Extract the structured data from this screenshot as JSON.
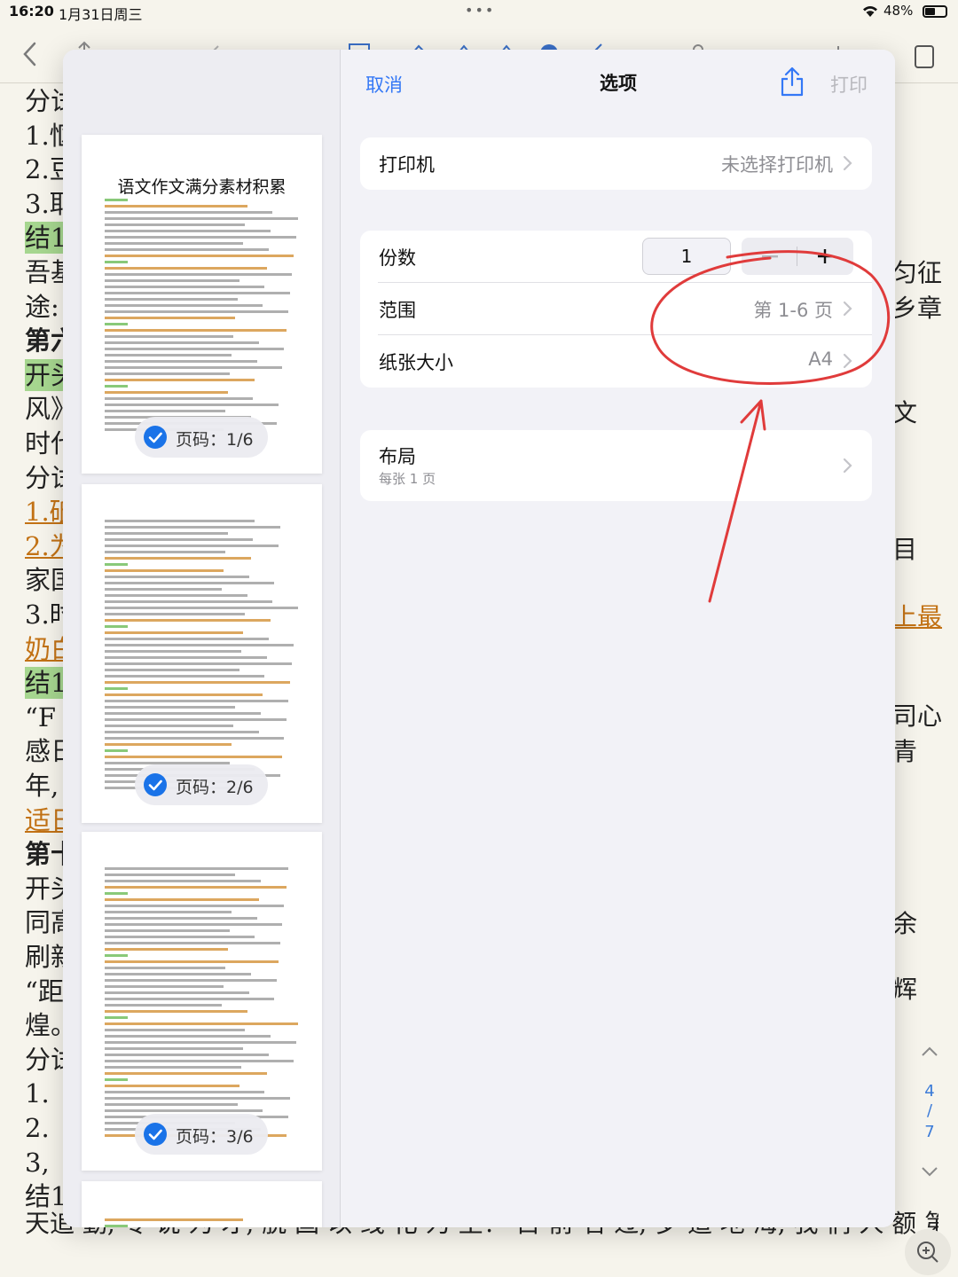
{
  "status_bar": {
    "time": "16:20",
    "date": "1月31日周三",
    "dots": "•••",
    "battery_text": "48%",
    "battery_level": 0.48
  },
  "background_doc": {
    "left_lines": [
      {
        "text": "分试",
        "style": "normal"
      },
      {
        "text": "1.怄",
        "style": "normal"
      },
      {
        "text": "2.豆",
        "style": "normal"
      },
      {
        "text": "3.耶",
        "style": "normal"
      },
      {
        "text": "结1",
        "style": "green"
      },
      {
        "text": "吾基",
        "style": "normal"
      },
      {
        "text": "途:",
        "style": "normal"
      },
      {
        "text": "第六",
        "style": "bold"
      },
      {
        "text": "开头",
        "style": "green"
      },
      {
        "text": "风》",
        "style": "normal"
      },
      {
        "text": "时代",
        "style": "normal"
      },
      {
        "text": "分试",
        "style": "normal"
      },
      {
        "text": "1.砥",
        "style": "orange"
      },
      {
        "text": "2.为",
        "style": "orange"
      },
      {
        "text": "家国",
        "style": "normal"
      },
      {
        "text": "3.时",
        "style": "normal"
      },
      {
        "text": "奶白",
        "style": "orange"
      },
      {
        "text": "结1",
        "style": "green"
      },
      {
        "text": "“F",
        "style": "normal"
      },
      {
        "text": "感日",
        "style": "normal"
      },
      {
        "text": "年,",
        "style": "normal"
      },
      {
        "text": "适日",
        "style": "orange"
      },
      {
        "text": "第十",
        "style": "bold"
      },
      {
        "text": "开头",
        "style": "normal"
      },
      {
        "text": "同高",
        "style": "normal"
      },
      {
        "text": "刷新",
        "style": "normal"
      },
      {
        "text": "“距",
        "style": "normal"
      },
      {
        "text": "煌。",
        "style": "normal"
      },
      {
        "text": "分试",
        "style": "normal"
      },
      {
        "text": "1.",
        "style": "normal"
      },
      {
        "text": "2.",
        "style": "normal"
      },
      {
        "text": "3,",
        "style": "normal"
      },
      {
        "text": "结1",
        "style": "normal"
      }
    ],
    "right_lines": [
      {
        "text": "匀征",
        "style": "normal"
      },
      {
        "text": "乡章",
        "style": "normal"
      },
      {
        "text": "文",
        "style": "normal"
      },
      {
        "text": "目",
        "style": "normal"
      },
      {
        "text": "上最",
        "style": "orange"
      },
      {
        "text": "司心",
        "style": "normal"
      },
      {
        "text": "青",
        "style": "normal"
      },
      {
        "text": "余",
        "style": "normal"
      },
      {
        "text": "辉",
        "style": "normal"
      }
    ],
    "bottom_line": "天追 勤,  专 说 为 才,  脱 国 以 线 化 为 主！  目 前 名 过,  岁 造 地 海,  我 们 人 额 第 一",
    "page_current": "4",
    "page_sep": "/",
    "page_total": "7"
  },
  "sheet": {
    "cancel_label": "取消",
    "title": "选项",
    "print_label": "打印",
    "printer": {
      "label": "打印机",
      "value": "未选择打印机"
    },
    "copies": {
      "label": "份数",
      "value": "1",
      "minus": "−",
      "plus": "+"
    },
    "range": {
      "label": "范围",
      "value": "第 1-6 页"
    },
    "paper": {
      "label": "纸张大小",
      "value": "A4"
    },
    "layout": {
      "label": "布局",
      "subtitle": "每张 1 页"
    }
  },
  "previews": [
    {
      "title": "语文作文满分素材积累",
      "badge": "页码：1/6",
      "checked": true
    },
    {
      "title": "",
      "badge": "页码：2/6",
      "checked": true
    },
    {
      "title": "",
      "badge": "页码：3/6",
      "checked": true
    }
  ],
  "colors": {
    "accent": "#3478f6",
    "annotation": "#e03b3b",
    "highlight_green": "#a6d68f",
    "link_orange": "#c27215"
  }
}
